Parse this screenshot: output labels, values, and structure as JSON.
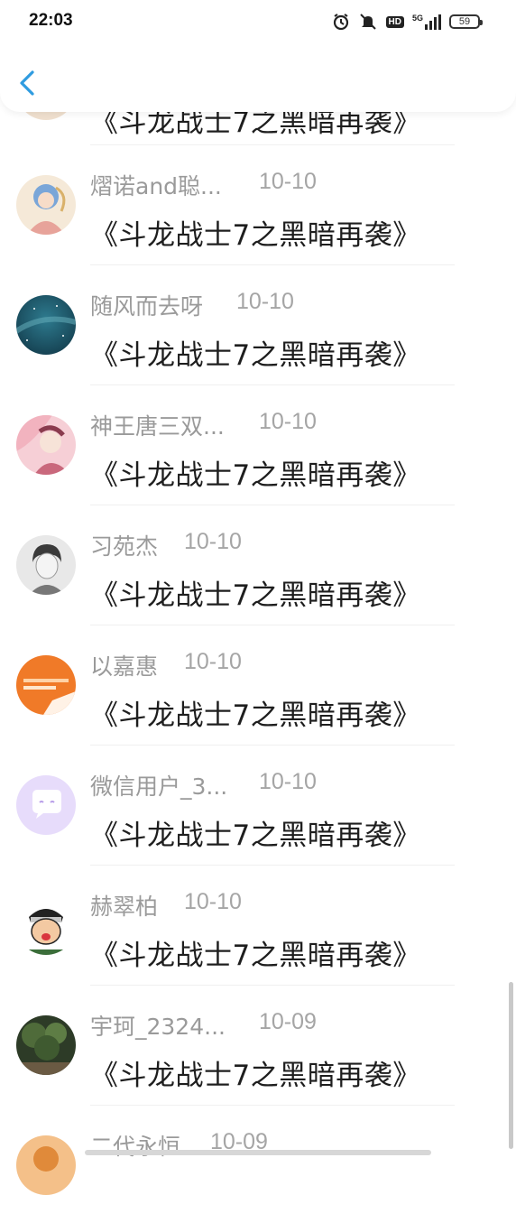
{
  "status_bar": {
    "time": "22:03",
    "network": "5G",
    "hd": "HD",
    "battery": "59"
  },
  "header": {
    "back_icon": "chevron-left-icon"
  },
  "comments": [
    {
      "user": "",
      "date": "",
      "text": "《斗龙战士7之黑暗再袭》",
      "avatar": "partial-avatar"
    },
    {
      "user": "熠诺and聪...",
      "date": "10-10",
      "text": "《斗龙战士7之黑暗再袭》",
      "avatar": "anime-girl-avatar"
    },
    {
      "user": "随风而去呀",
      "date": "10-10",
      "text": "《斗龙战士7之黑暗再袭》",
      "avatar": "starry-sky-avatar"
    },
    {
      "user": "神王唐三双...",
      "date": "10-10",
      "text": "《斗龙战士7之黑暗再袭》",
      "avatar": "anime-character-avatar"
    },
    {
      "user": "习苑杰",
      "date": "10-10",
      "text": "《斗龙战士7之黑暗再袭》",
      "avatar": "boy-sketch-avatar"
    },
    {
      "user": "以嘉惠",
      "date": "10-10",
      "text": "《斗龙战士7之黑暗再袭》",
      "avatar": "orange-logo-avatar"
    },
    {
      "user": "微信用户_3...",
      "date": "10-10",
      "text": "《斗龙战士7之黑暗再袭》",
      "avatar": "chat-bubble-avatar"
    },
    {
      "user": "赫翠柏",
      "date": "10-10",
      "text": "《斗龙战士7之黑暗再袭》",
      "avatar": "cartoon-ninja-avatar"
    },
    {
      "user": "宇珂_2324...",
      "date": "10-09",
      "text": "《斗龙战士7之黑暗再袭》",
      "avatar": "tree-photo-avatar"
    },
    {
      "user": "二代永恒",
      "date": "10-09",
      "text": "",
      "avatar": "partial-avatar"
    }
  ],
  "colors": {
    "accent": "#2f9ce0",
    "username": "#9a9a9a",
    "text": "#1e1e1e"
  }
}
